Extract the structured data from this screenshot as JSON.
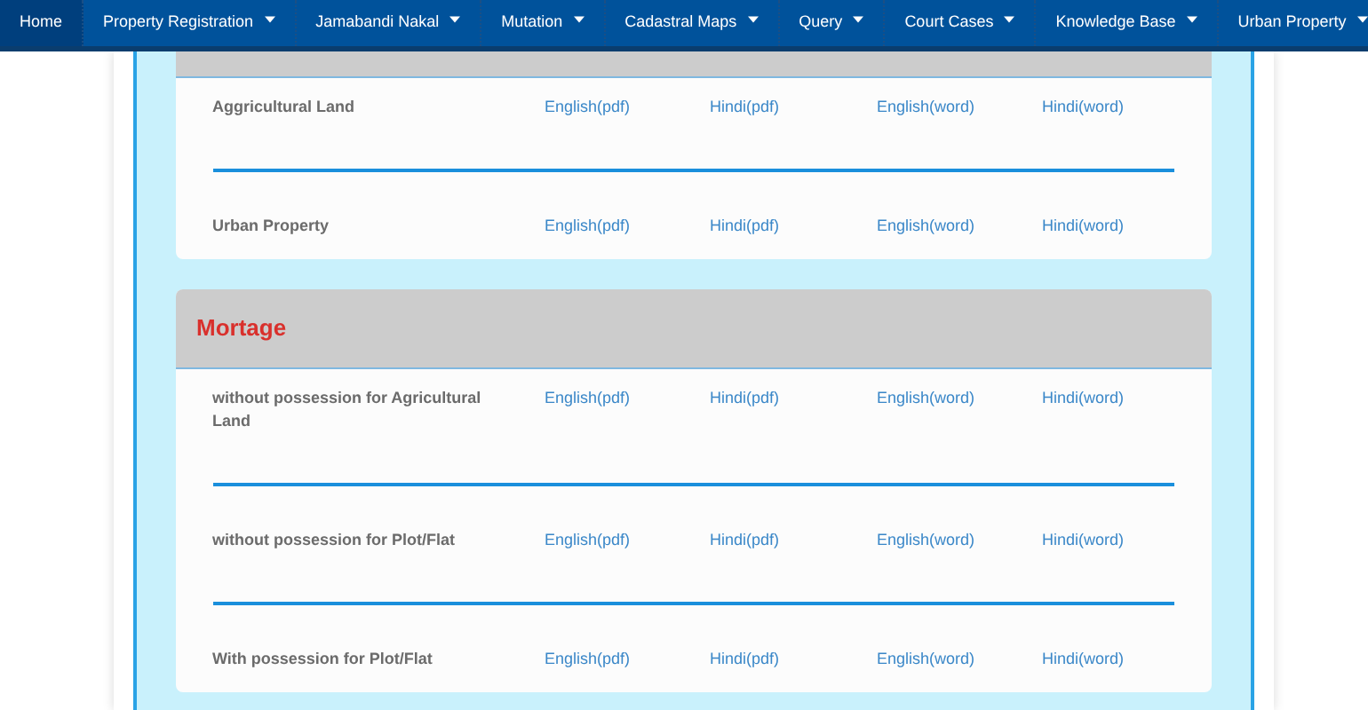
{
  "nav": [
    {
      "label": "Home",
      "selected": true,
      "has_menu": false
    },
    {
      "label": "Property Registration",
      "selected": false,
      "has_menu": true
    },
    {
      "label": "Jamabandi Nakal",
      "selected": false,
      "has_menu": true
    },
    {
      "label": "Mutation",
      "selected": false,
      "has_menu": true
    },
    {
      "label": "Cadastral Maps",
      "selected": false,
      "has_menu": true
    },
    {
      "label": "Query",
      "selected": false,
      "has_menu": true
    },
    {
      "label": "Court Cases",
      "selected": false,
      "has_menu": true
    },
    {
      "label": "Knowledge Base",
      "selected": false,
      "has_menu": true
    },
    {
      "label": "Urban Property",
      "selected": false,
      "has_menu": true
    }
  ],
  "sections": [
    {
      "rows": [
        {
          "label": "Aggricultural Land",
          "links": [
            "English(pdf)",
            "Hindi(pdf)",
            "English(word)",
            "Hindi(word)"
          ]
        },
        {
          "label": "Urban Property",
          "links": [
            "English(pdf)",
            "Hindi(pdf)",
            "English(word)",
            "Hindi(word)"
          ]
        }
      ]
    },
    {
      "title": "Mortage",
      "rows": [
        {
          "label": "without possession for Agricultural Land",
          "links": [
            "English(pdf)",
            "Hindi(pdf)",
            "English(word)",
            "Hindi(word)"
          ]
        },
        {
          "label": "without possession for Plot/Flat",
          "links": [
            "English(pdf)",
            "Hindi(pdf)",
            "English(word)",
            "Hindi(word)"
          ]
        },
        {
          "label": "With possession for Plot/Flat",
          "links": [
            "English(pdf)",
            "Hindi(pdf)",
            "English(word)",
            "Hindi(word)"
          ]
        }
      ]
    }
  ]
}
